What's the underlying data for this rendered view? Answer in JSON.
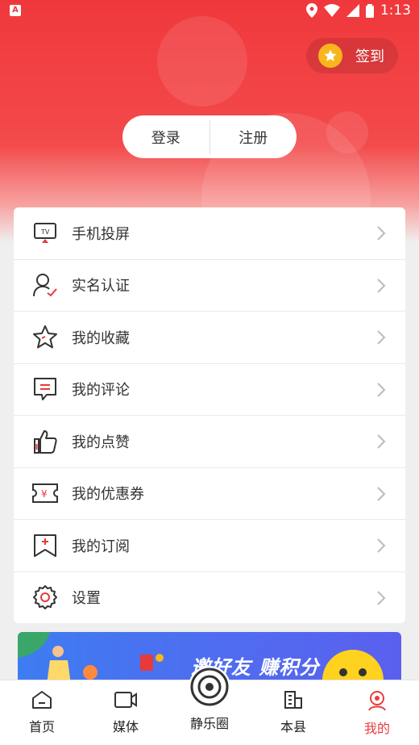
{
  "status": {
    "time": "1:13",
    "app_badge": "A"
  },
  "header": {
    "signin_label": "签到",
    "login_label": "登录",
    "register_label": "注册"
  },
  "menu": [
    {
      "icon": "tv-cast-icon",
      "label": "手机投屏"
    },
    {
      "icon": "verified-user-icon",
      "label": "实名认证"
    },
    {
      "icon": "star-icon",
      "label": "我的收藏"
    },
    {
      "icon": "comment-icon",
      "label": "我的评论"
    },
    {
      "icon": "thumbs-up-icon",
      "label": "我的点赞"
    },
    {
      "icon": "coupon-icon",
      "label": "我的优惠券"
    },
    {
      "icon": "bookmark-icon",
      "label": "我的订阅"
    },
    {
      "icon": "gear-icon",
      "label": "设置"
    }
  ],
  "banner": {
    "text": "邀好友 赚积分"
  },
  "tabs": [
    {
      "icon": "home-icon",
      "label": "首页"
    },
    {
      "icon": "video-icon",
      "label": "媒体"
    },
    {
      "icon": "circle-logo-icon",
      "label": "静乐圈"
    },
    {
      "icon": "building-icon",
      "label": "本县"
    },
    {
      "icon": "profile-icon",
      "label": "我的"
    }
  ],
  "colors": {
    "accent": "#f0383c",
    "active_tab": "#ec3c3c",
    "coin": "#f9b51c"
  }
}
